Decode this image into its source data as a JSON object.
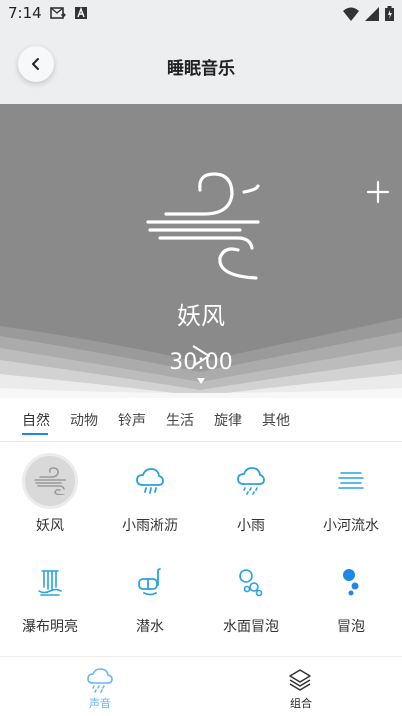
{
  "status_bar": {
    "time": "7:14",
    "left_icons": [
      "message-icon",
      "app-a-icon"
    ],
    "right_icons": [
      "wifi-icon",
      "signal-icon",
      "battery-icon"
    ]
  },
  "header": {
    "title": "睡眠音乐",
    "back_icon": "chevron-left-icon"
  },
  "player": {
    "sound_name": "妖风",
    "timer": "30:00",
    "icon": "wind-icon",
    "add_icon": "plus-icon",
    "play_icon": "play-icon"
  },
  "tabs": [
    {
      "label": "自然",
      "active": true
    },
    {
      "label": "动物",
      "active": false
    },
    {
      "label": "铃声",
      "active": false
    },
    {
      "label": "生活",
      "active": false
    },
    {
      "label": "旋律",
      "active": false
    },
    {
      "label": "其他",
      "active": false
    }
  ],
  "sounds": [
    {
      "label": "妖风",
      "icon": "wind-icon",
      "selected": true
    },
    {
      "label": "小雨淅沥",
      "icon": "cloud-drizzle-icon",
      "selected": false
    },
    {
      "label": "小雨",
      "icon": "cloud-rain-icon",
      "selected": false
    },
    {
      "label": "小河流水",
      "icon": "water-waves-icon",
      "selected": false
    },
    {
      "label": "瀑布明亮",
      "icon": "waterfall-icon",
      "selected": false
    },
    {
      "label": "潜水",
      "icon": "diving-mask-icon",
      "selected": false
    },
    {
      "label": "水面冒泡",
      "icon": "bubbles-icon",
      "selected": false
    },
    {
      "label": "冒泡",
      "icon": "bubble-dots-icon",
      "selected": false
    }
  ],
  "bottom_nav": [
    {
      "label": "声音",
      "icon": "cloud-rain-icon",
      "active": true
    },
    {
      "label": "组合",
      "icon": "layers-icon",
      "active": false
    }
  ],
  "colors": {
    "accent": "#1e88e5",
    "icon_blue": "#29a3e0",
    "hero_bg": "#8a8a8a",
    "header_bg": "#eceef0"
  }
}
